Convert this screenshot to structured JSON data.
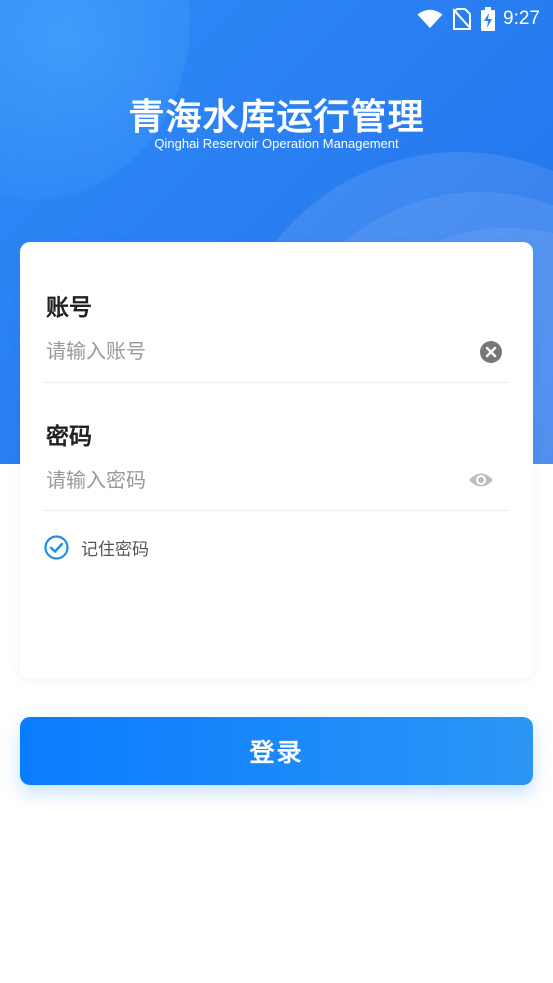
{
  "status_bar": {
    "time": "9:27",
    "icons": [
      "wifi-icon",
      "no-sim-icon",
      "battery-charging-icon"
    ]
  },
  "header": {
    "title": "青海水库运行管理",
    "subtitle": "Qinghai Reservoir Operation Management"
  },
  "form": {
    "account": {
      "label": "账号",
      "placeholder": "请输入账号",
      "value": "",
      "clear_icon": "clear-circle-icon"
    },
    "password": {
      "label": "密码",
      "placeholder": "请输入密码",
      "value": "",
      "toggle_icon": "eye-icon"
    },
    "remember": {
      "label": "记住密码",
      "checked": true,
      "icon": "check-circle-icon"
    }
  },
  "login_button": {
    "label": "登录"
  },
  "colors": {
    "primary": "#1f82f5",
    "button_start": "#0a7cff",
    "button_end": "#2b95f5",
    "check": "#1e8fe6"
  }
}
